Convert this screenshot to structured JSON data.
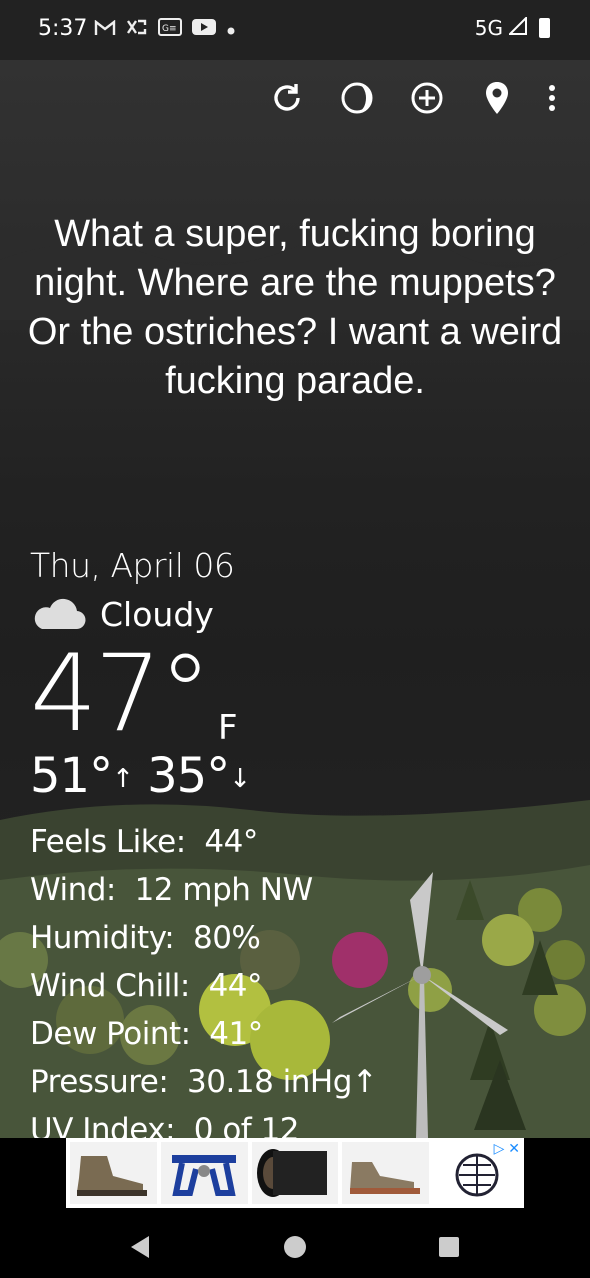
{
  "status_bar": {
    "time": "5:37",
    "network": "5G",
    "icons": [
      "gmail-icon",
      "shuffle-icon",
      "news-icon",
      "youtube-icon",
      "dot-icon"
    ]
  },
  "toolbar": {
    "icons": [
      "refresh-icon",
      "moon-icon",
      "add-location-icon",
      "location-pin-icon",
      "more-vert-icon"
    ]
  },
  "headline": "What a super, fucking boring night. Where are the muppets? Or the ostriches? I want a weird fucking parade.",
  "weather": {
    "date": "Thu, April 06",
    "condition": "Cloudy",
    "condition_icon": "cloud-icon",
    "temperature": "47°",
    "unit": "F",
    "high": "51°",
    "low": "35°",
    "details": [
      {
        "label": "Feels Like:",
        "value": "44°"
      },
      {
        "label": "Wind:",
        "value": "12 mph NW"
      },
      {
        "label": "Humidity:",
        "value": "80%"
      },
      {
        "label": "Wind Chill:",
        "value": "44°"
      },
      {
        "label": "Dew Point:",
        "value": "41°"
      },
      {
        "label": "Pressure:",
        "value": "30.18 inHg↑"
      },
      {
        "label": "UV Index:",
        "value": "0 of 12"
      }
    ]
  },
  "ad": {
    "items": [
      "hiking-boot-image",
      "climbing-harness-image",
      "camera-lens-image",
      "trail-shoe-image",
      "brand-logo-image"
    ],
    "choices_label": "▷ ✕"
  },
  "nav_bar": {
    "buttons": [
      "back-icon",
      "home-icon",
      "recents-icon"
    ]
  },
  "colors": {
    "background": "#202020",
    "hills": "#3f4a35",
    "text": "#ffffff"
  }
}
